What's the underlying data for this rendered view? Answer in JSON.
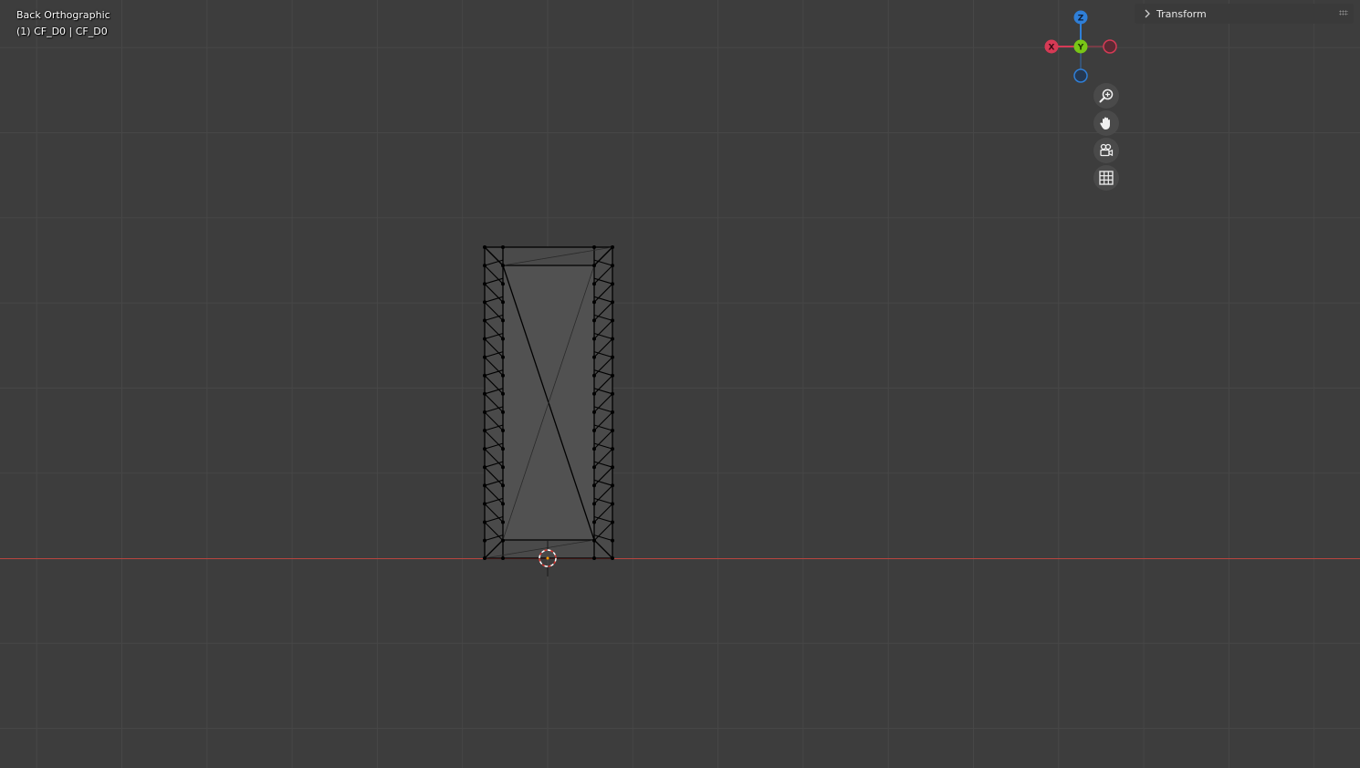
{
  "viewport": {
    "view_name": "Back Orthographic",
    "object_info": "(1) CF_D0 | CF_D0",
    "background_color": "#3d3d3d",
    "grid_color": "#474747",
    "x_axis_color": "#c2413c"
  },
  "gizmo": {
    "z_label": "Z",
    "x_label": "X",
    "y_label": "Y",
    "z_color": "#2f7fd8",
    "x_color": "#d63a55",
    "y_color": "#79c617",
    "neg_x_color": "#d63a55",
    "neg_z_color": "#2f7fd8"
  },
  "nav_buttons": {
    "zoom": "zoom-icon",
    "pan": "hand-icon",
    "camera": "camera-icon",
    "ortho": "grid-icon"
  },
  "npanel": {
    "title": "Transform"
  }
}
